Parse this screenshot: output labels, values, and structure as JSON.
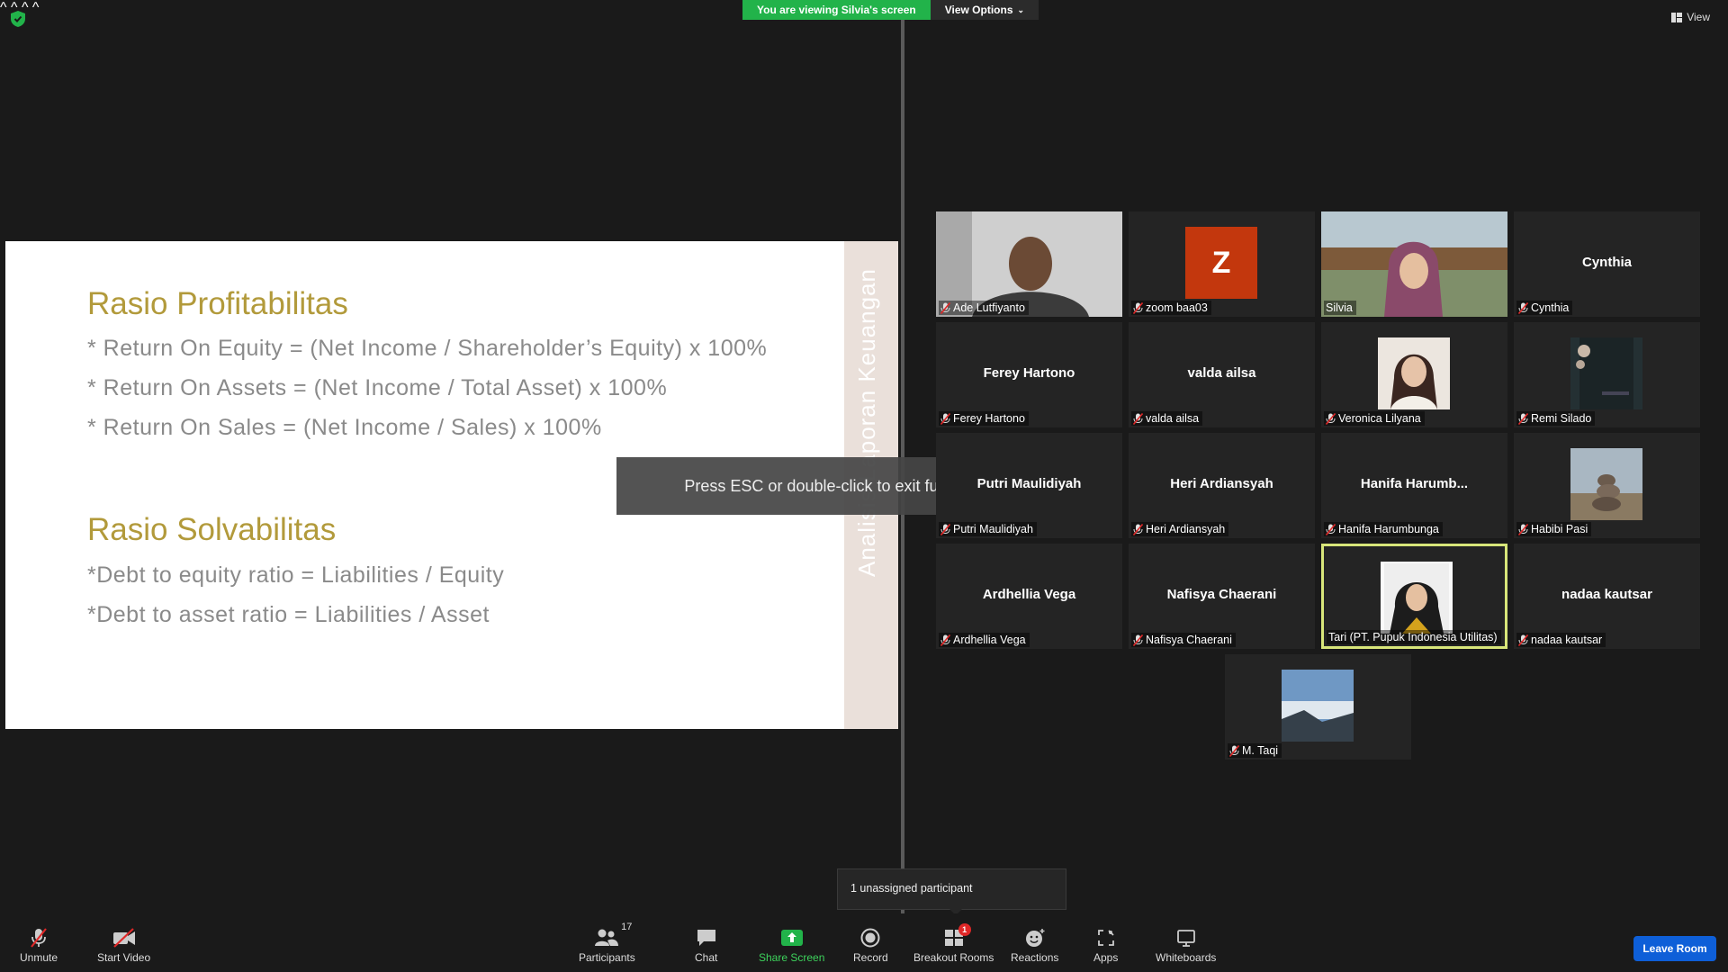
{
  "banner": {
    "viewing": "You are viewing Silvia's screen",
    "view_options": "View Options"
  },
  "top_right": {
    "view": "View"
  },
  "slide": {
    "heading1": "Rasio Profitabilitas",
    "lines1": [
      "* Return On Equity = (Net Income / Shareholder’s Equity) x 100%",
      "* Return On Assets = (Net Income / Total Asset) x 100%",
      "* Return On Sales = (Net Income / Sales) x 100%"
    ],
    "heading2": "Rasio Solvabilitas",
    "lines2": [
      "*Debt to equity ratio = Liabilities / Equity",
      "*Debt to asset ratio = Liabilities / Asset"
    ],
    "vertical": "Analisis Laporan Keuangan"
  },
  "esc_toast": "Press ESC or double-click to exit full screen mode",
  "participants": [
    {
      "display": "",
      "label": "Ade Lutfiyanto",
      "muted": true,
      "kind": "video-man"
    },
    {
      "display": "Z",
      "label": "zoom baa03",
      "muted": true,
      "kind": "avatar"
    },
    {
      "display": "",
      "label": "Silvia",
      "muted": false,
      "kind": "video-woman"
    },
    {
      "display": "Cynthia",
      "label": "Cynthia",
      "muted": true,
      "kind": "name"
    },
    {
      "display": "Ferey Hartono",
      "label": "Ferey Hartono",
      "muted": true,
      "kind": "name"
    },
    {
      "display": "valda ailsa",
      "label": "valda ailsa",
      "muted": true,
      "kind": "name"
    },
    {
      "display": "",
      "label": "Veronica Lilyana",
      "muted": true,
      "kind": "photo-woman"
    },
    {
      "display": "",
      "label": "Remi Silado",
      "muted": true,
      "kind": "photo-dark"
    },
    {
      "display": "Putri Maulidiyah",
      "label": "Putri Maulidiyah",
      "muted": true,
      "kind": "name"
    },
    {
      "display": "Heri Ardiansyah",
      "label": "Heri Ardiansyah",
      "muted": true,
      "kind": "name"
    },
    {
      "display": "Hanifa  Harumb...",
      "label": "Hanifa Harumbunga",
      "muted": true,
      "kind": "name"
    },
    {
      "display": "",
      "label": "Habibi Pasi",
      "muted": true,
      "kind": "photo-rocks"
    },
    {
      "display": "Ardhellia Vega",
      "label": "Ardhellia Vega",
      "muted": true,
      "kind": "name"
    },
    {
      "display": "Nafisya Chaerani",
      "label": "Nafisya Chaerani",
      "muted": true,
      "kind": "name"
    },
    {
      "display": "",
      "label": "Tari (PT. Pupuk Indonesia Utilitas)",
      "muted": false,
      "kind": "photo-hijab",
      "active": true
    },
    {
      "display": "nadaa kautsar",
      "label": "nadaa kautsar",
      "muted": true,
      "kind": "name"
    },
    {
      "display": "",
      "label": "M. Taqi",
      "muted": true,
      "kind": "photo-mountain"
    }
  ],
  "unassigned": "1 unassigned participant",
  "toolbar": {
    "unmute": "Unmute",
    "start_video": "Start Video",
    "participants": "Participants",
    "participants_count": "17",
    "chat": "Chat",
    "share_screen": "Share Screen",
    "record": "Record",
    "breakout_rooms": "Breakout Rooms",
    "breakout_badge": "1",
    "reactions": "Reactions",
    "apps": "Apps",
    "whiteboards": "Whiteboards",
    "leave": "Leave Room"
  },
  "colors": {
    "share_green": "#22b34a",
    "leave_blue": "#0e5fd8",
    "slide_heading": "#b29a3b",
    "active_speaker": "#d8e67a",
    "avatar_z": "#c3370d"
  }
}
